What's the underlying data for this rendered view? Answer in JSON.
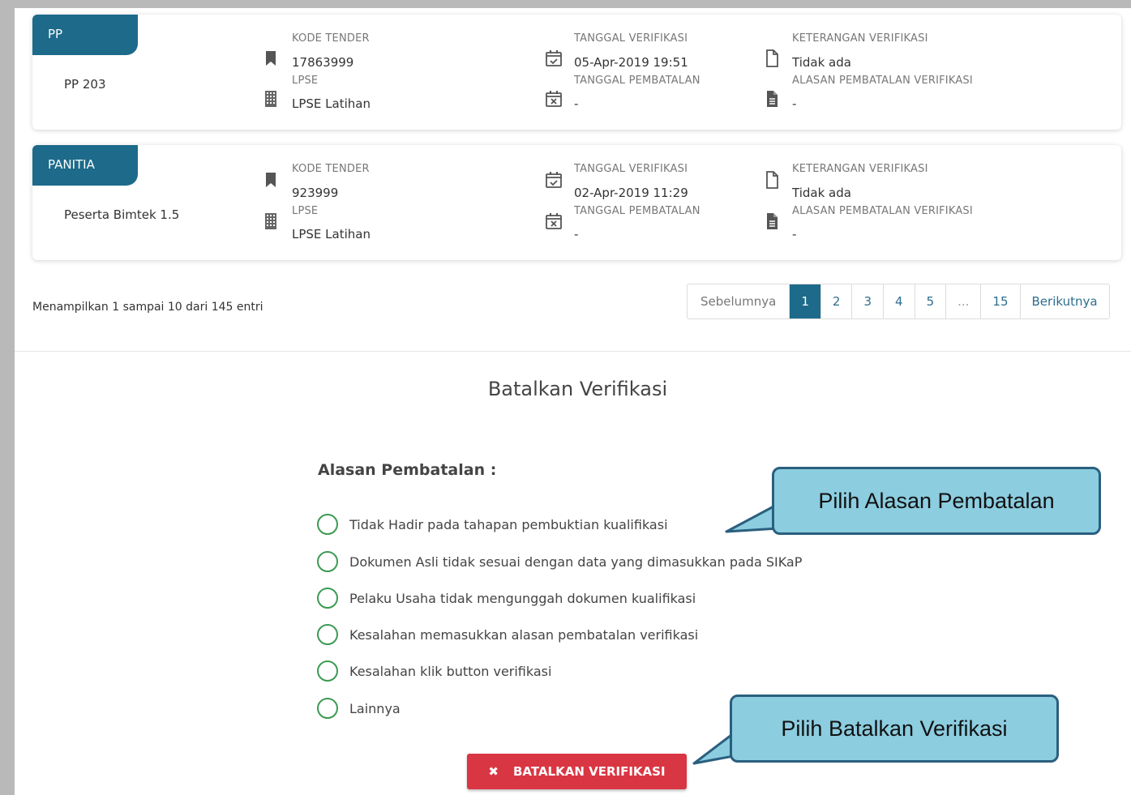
{
  "cards": [
    {
      "tag": "PP",
      "name": "PP 203",
      "kode_tender_label": "KODE TENDER",
      "kode_tender": "17863999",
      "lpse_label": "LPSE",
      "lpse": "LPSE Latihan",
      "tgl_verifikasi_label": "TANGGAL VERIFIKASI",
      "tgl_verifikasi": "05-Apr-2019 19:51",
      "tgl_pembatalan_label": "TANGGAL PEMBATALAN",
      "tgl_pembatalan": "-",
      "ket_verifikasi_label": "KETERANGAN VERIFIKASI",
      "ket_verifikasi": "Tidak ada",
      "alasan_label": "ALASAN PEMBATALAN VERIFIKASI",
      "alasan": "-"
    },
    {
      "tag": "PANITIA",
      "name": "Peserta Bimtek 1.5",
      "kode_tender_label": "KODE TENDER",
      "kode_tender": "923999",
      "lpse_label": "LPSE",
      "lpse": "LPSE Latihan",
      "tgl_verifikasi_label": "TANGGAL VERIFIKASI",
      "tgl_verifikasi": "02-Apr-2019 11:29",
      "tgl_pembatalan_label": "TANGGAL PEMBATALAN",
      "tgl_pembatalan": "-",
      "ket_verifikasi_label": "KETERANGAN VERIFIKASI",
      "ket_verifikasi": "Tidak ada",
      "alasan_label": "ALASAN PEMBATALAN VERIFIKASI",
      "alasan": "-"
    }
  ],
  "table_info": "Menampilkan 1 sampai 10 dari 145 entri",
  "pagination": {
    "prev": "Sebelumnya",
    "pages": [
      "1",
      "2",
      "3",
      "4",
      "5",
      "...",
      "15"
    ],
    "active": "1",
    "next": "Berikutnya"
  },
  "modal": {
    "title": "Batalkan Verifikasi",
    "reason_label": "Alasan Pembatalan :",
    "options": [
      "Tidak Hadir pada tahapan pembuktian kualifikasi",
      "Dokumen Asli tidak sesuai dengan data yang dimasukkan pada SIKaP",
      "Pelaku Usaha tidak mengunggah dokumen kualifikasi",
      "Kesalahan memasukkan alasan pembatalan verifikasi",
      "Kesalahan klik button verifikasi",
      "Lainnya"
    ],
    "cancel_button": "BATALKAN VERIFIKASI"
  },
  "callouts": {
    "select_reason": "Pilih Alasan Pembatalan",
    "select_cancel": "Pilih Batalkan Verifikasi"
  },
  "colors": {
    "primary": "#1d6a8a",
    "danger": "#d93643",
    "radio": "#3c9a54",
    "callout_fill": "#8ccde0",
    "callout_border": "#2a5f7e"
  }
}
